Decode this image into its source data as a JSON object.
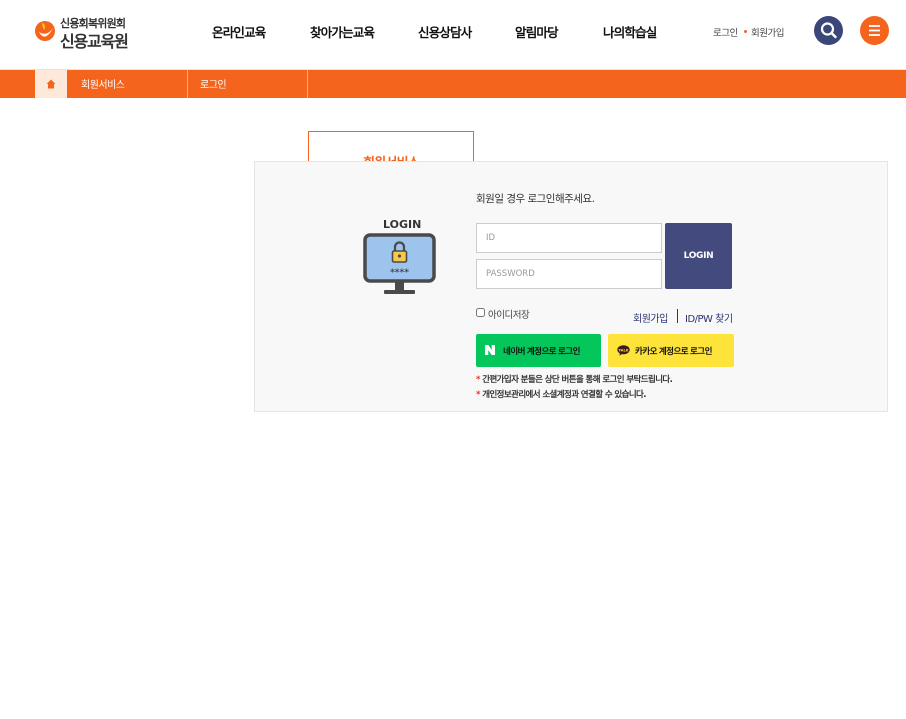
{
  "header": {
    "logo_small": "신용회복위원회",
    "logo_big": "신용교육원",
    "nav": [
      "온라인교육",
      "찾아가는교육",
      "신용상담사",
      "알림마당",
      "나의학습실"
    ],
    "util_login": "로그인",
    "util_join": "회원가입",
    "search_icon": "search-icon",
    "menu_icon": "hamburger-menu-icon"
  },
  "breadcrumb": {
    "home_icon": "home-icon",
    "items": [
      "회원서비스",
      "로그인"
    ]
  },
  "side": {
    "title": "회원서비스"
  },
  "login": {
    "caption": "LOGIN",
    "intro": "회원일 경우 로그인해주세요.",
    "id_placeholder": "ID",
    "pw_placeholder": "PASSWORD",
    "login_button": "LOGIN",
    "save_id_label": "아이디저장",
    "join_link": "회원가입",
    "find_link": "ID/PW 찾기",
    "naver_label": "네이버 계정으로 로그인",
    "kakao_label": "카카오 계정으로 로그인",
    "notes": [
      "간편가입자 분들은 상단 버튼을 통해 로그인 부탁드립니다.",
      "개인정보관리에서 소셜계정과 연결할 수 있습니다."
    ]
  },
  "colors": {
    "brand_orange": "#f4641c",
    "navy": "#434a7e",
    "naver_green": "#03c75a",
    "kakao_yellow": "#fee33a"
  }
}
